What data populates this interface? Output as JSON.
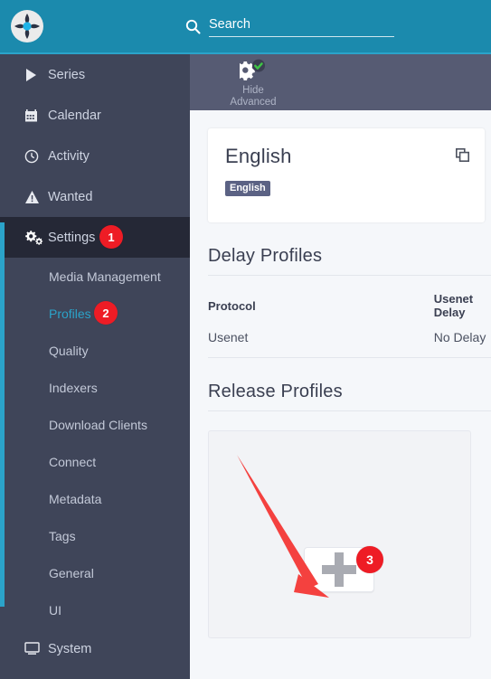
{
  "header": {
    "logo_icon": "sonarr-logo-icon",
    "search": {
      "icon": "search-icon",
      "placeholder": "Search",
      "value": ""
    },
    "background_color": "#1b8aad"
  },
  "sidebar": {
    "background_color": "#3f4559",
    "accent_color": "#2ba3c9",
    "items": [
      {
        "label": "Series",
        "icon": "play-icon",
        "name": "series"
      },
      {
        "label": "Calendar",
        "icon": "calendar-icon",
        "name": "calendar"
      },
      {
        "label": "Activity",
        "icon": "clock-icon",
        "name": "activity"
      },
      {
        "label": "Wanted",
        "icon": "warning-triangle-icon",
        "name": "wanted"
      },
      {
        "label": "Settings",
        "icon": "gears-icon",
        "name": "settings",
        "active": true,
        "badge": "1"
      },
      {
        "label": "System",
        "icon": "monitor-icon",
        "name": "system"
      }
    ],
    "settings_children": [
      {
        "label": "Media Management",
        "name": "media-management"
      },
      {
        "label": "Profiles",
        "name": "profiles",
        "current": true,
        "badge": "2"
      },
      {
        "label": "Quality",
        "name": "quality"
      },
      {
        "label": "Indexers",
        "name": "indexers"
      },
      {
        "label": "Download Clients",
        "name": "download-clients"
      },
      {
        "label": "Connect",
        "name": "connect"
      },
      {
        "label": "Metadata",
        "name": "metadata"
      },
      {
        "label": "Tags",
        "name": "tags"
      },
      {
        "label": "General",
        "name": "general"
      },
      {
        "label": "UI",
        "name": "ui"
      }
    ]
  },
  "toolbar": {
    "background_color": "#565b73",
    "hide_advanced": {
      "line1": "Hide",
      "line2": "Advanced",
      "icon": "gear-check-icon"
    }
  },
  "main": {
    "language_profile_card": {
      "title": "English",
      "clone_icon": "clone-icon",
      "tags": [
        "English"
      ],
      "tag_color": "#5b6284"
    },
    "delay_profiles": {
      "heading": "Delay Profiles",
      "columns": [
        "Protocol",
        "Usenet Delay"
      ],
      "rows": [
        [
          "Usenet",
          "No Delay"
        ]
      ]
    },
    "release_profiles": {
      "heading": "Release Profiles",
      "add_button": {
        "icon": "plus-icon",
        "badge": "3"
      }
    }
  },
  "annotations": {
    "arrow_color": "#f4413f",
    "badge_color": "#ee1c25",
    "steps": [
      "1",
      "2",
      "3"
    ]
  }
}
